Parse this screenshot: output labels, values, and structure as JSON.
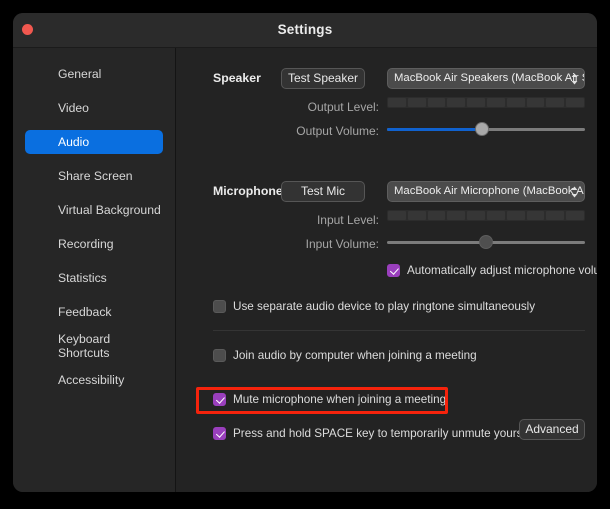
{
  "window": {
    "title": "Settings",
    "close_icon": "close-dot-icon",
    "accent_selected": "#0a6fe0",
    "accent_checkbox": "#9a3fbd",
    "annotation_color": "#f5230c"
  },
  "sidebar": {
    "items": [
      {
        "label": "General",
        "selected": false
      },
      {
        "label": "Video",
        "selected": false
      },
      {
        "label": "Audio",
        "selected": true
      },
      {
        "label": "Share Screen",
        "selected": false
      },
      {
        "label": "Virtual Background",
        "selected": false
      },
      {
        "label": "Recording",
        "selected": false
      },
      {
        "label": "Statistics",
        "selected": false
      },
      {
        "label": "Feedback",
        "selected": false
      },
      {
        "label": "Keyboard Shortcuts",
        "selected": false
      },
      {
        "label": "Accessibility",
        "selected": false
      }
    ]
  },
  "speaker": {
    "section_label": "Speaker",
    "test_button": "Test Speaker",
    "device_selected": "MacBook Air Speakers (MacBook Air S...",
    "output_level_label": "Output Level:",
    "output_level_value": 0,
    "output_volume_label": "Output Volume:",
    "output_volume_value": 48
  },
  "microphone": {
    "section_label": "Microphone",
    "test_button": "Test Mic",
    "device_selected": "MacBook Air Microphone (MacBook Air...",
    "input_level_label": "Input Level:",
    "input_level_value": 0,
    "input_volume_label": "Input Volume:",
    "input_volume_value": 50,
    "auto_adjust_label": "Automatically adjust microphone volume",
    "auto_adjust_checked": true
  },
  "options": {
    "separate_device_label": "Use separate audio device to play ringtone simultaneously",
    "separate_device_checked": false,
    "join_audio_label": "Join audio by computer when joining a meeting",
    "join_audio_checked": false,
    "mute_mic_label": "Mute microphone when joining a meeting",
    "mute_mic_checked": true,
    "push_to_talk_label": "Press and hold SPACE key to temporarily unmute yourself",
    "push_to_talk_checked": true
  },
  "footer": {
    "advanced_button": "Advanced"
  }
}
